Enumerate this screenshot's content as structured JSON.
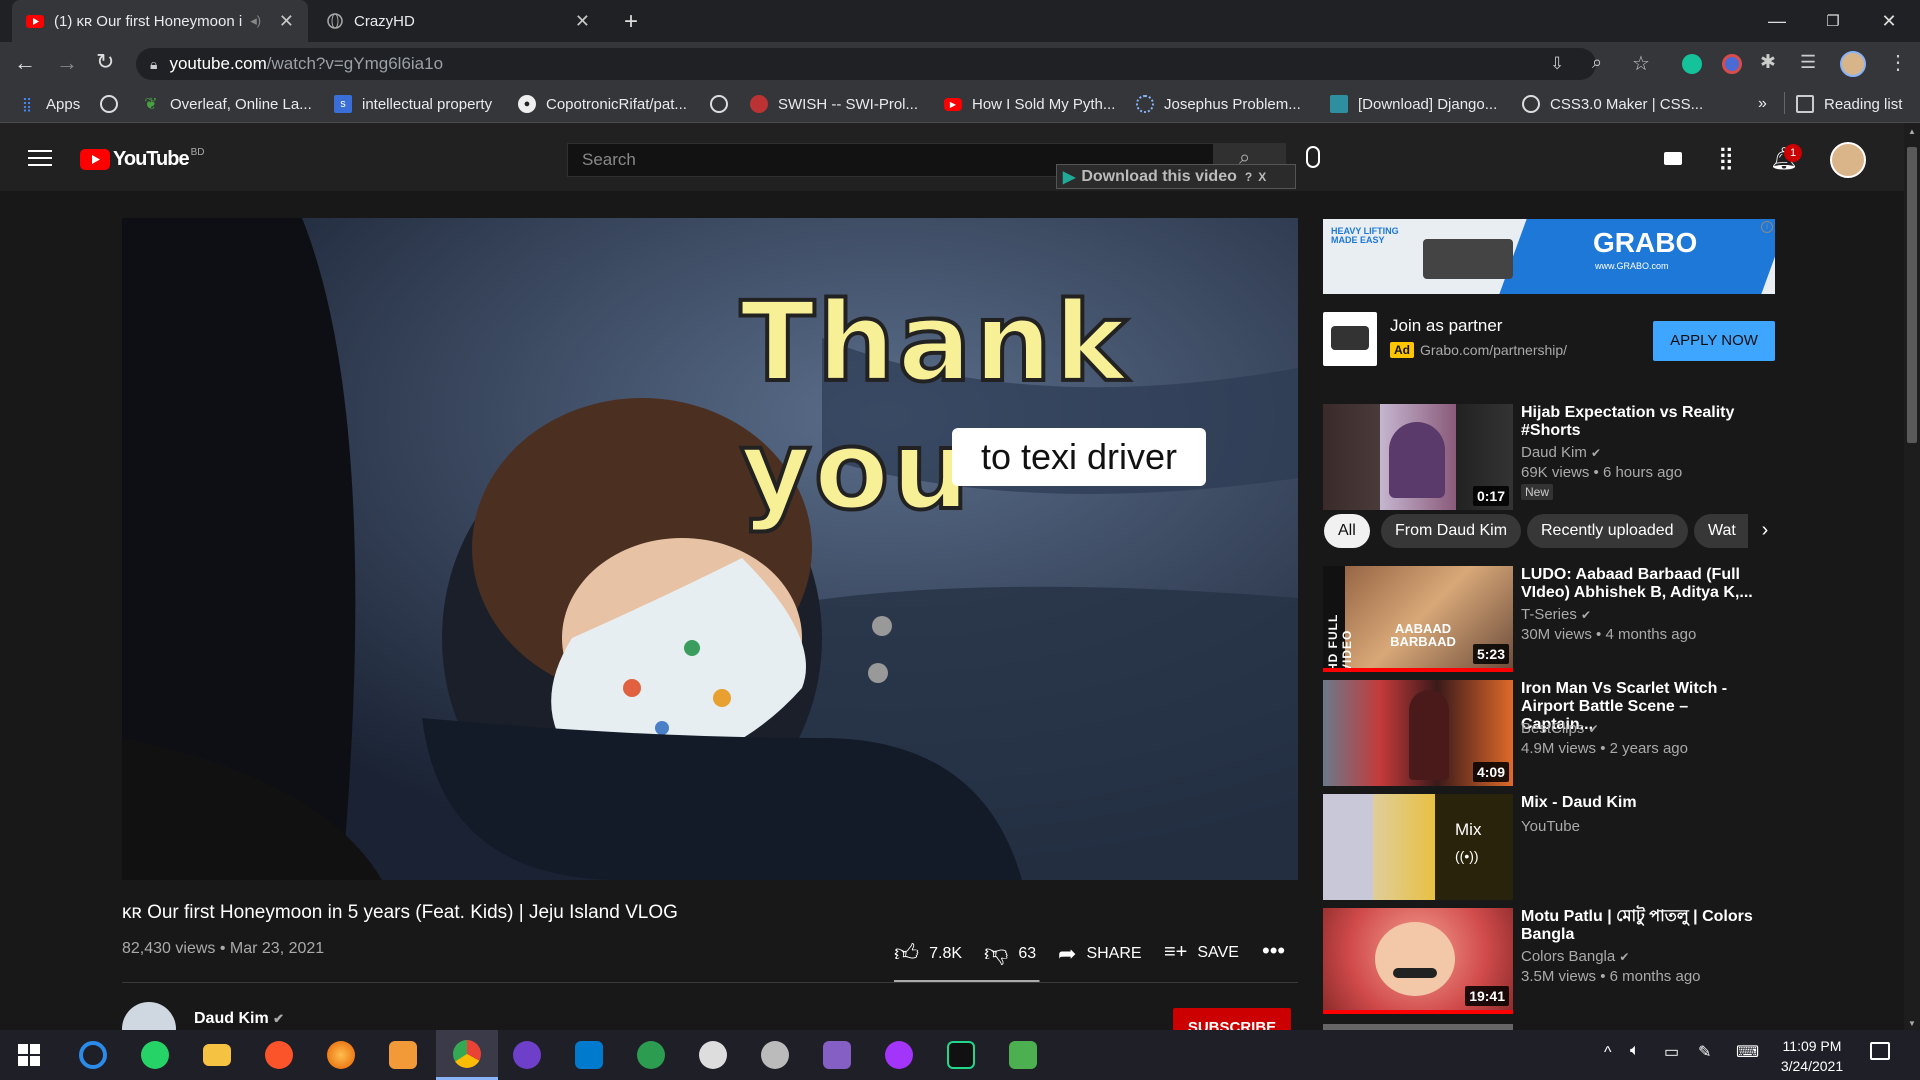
{
  "browser": {
    "tabs": [
      {
        "title": "(1) ᴋʀ Our first Honeymoon i",
        "active": true
      },
      {
        "title": "CrazyHD",
        "active": false
      }
    ],
    "url_domain": "youtube.com",
    "url_path": "/watch?v=gYmg6l6ia1o",
    "bookmarks": [
      "Apps",
      "Overleaf, Online La...",
      "intellectual property",
      "CopotronicRifat/pat...",
      "SWISH -- SWI-Prol...",
      "How I Sold My Pyth...",
      "Josephus Problem...",
      "[Download] Django...",
      "CSS3.0 Maker | CSS..."
    ],
    "reading_list": "Reading list",
    "more_bookmarks": "»"
  },
  "youtube": {
    "logo_text": "YouTube",
    "country": "BD",
    "search_placeholder": "Search",
    "notification_count": "1",
    "download_banner": "Download this video",
    "video_overlay_big": "Thank you",
    "video_overlay_small": "to texi driver",
    "video_title": "ᴋʀ Our first Honeymoon in 5 years (Feat. Kids) | Jeju Island VLOG",
    "views": "82,430 views",
    "date": "Mar 23, 2021",
    "likes": "7.8K",
    "dislikes": "63",
    "like_ratio": 0.992,
    "share": "SHARE",
    "save": "SAVE",
    "channel": "Daud Kim",
    "subscribe": "SUBSCRIBE",
    "ad": {
      "banner_text": "GRABO",
      "banner_tagline": "HEAVY LIFTING MADE EASY",
      "banner_url": "www.GRABO.com",
      "title": "Join as partner",
      "badge": "Ad",
      "url": "Grabo.com/partnership/",
      "cta": "APPLY NOW"
    },
    "chips": [
      "All",
      "From Daud Kim",
      "Recently uploaded",
      "Wat"
    ],
    "recommendations": [
      {
        "title": "Hijab Expectation vs Reality #Shorts",
        "channel": "Daud Kim",
        "verified": true,
        "meta": "69K views • 6 hours ago",
        "badge": "New",
        "duration": "0:17"
      },
      {
        "title": "LUDO: Aabaad Barbaad (Full VIdeo) Abhishek B, Aditya K,...",
        "channel": "T-Series",
        "verified": true,
        "meta": "30M views • 4 months ago",
        "duration": "5:23",
        "thumb_text": "AABAAD BARBAAD",
        "side_text": "HD FULL VIDEO"
      },
      {
        "title": "Iron Man Vs Scarlet Witch - Airport Battle Scene – Captain...",
        "channel": "BestClips",
        "verified": true,
        "meta": "4.9M views • 2 years ago",
        "duration": "4:09"
      },
      {
        "title": "Mix - Daud Kim",
        "channel": "YouTube",
        "verified": false,
        "meta": "",
        "mix_label": "Mix",
        "mix_icon": "((•))"
      },
      {
        "title": "Motu Patlu | মোটু পাতলু | Colors Bangla",
        "channel": "Colors Bangla",
        "verified": true,
        "meta": "3.5M views • 6 months ago",
        "duration": "19:41"
      }
    ]
  },
  "taskbar": {
    "time": "11:09 PM",
    "date": "3/24/2021"
  }
}
